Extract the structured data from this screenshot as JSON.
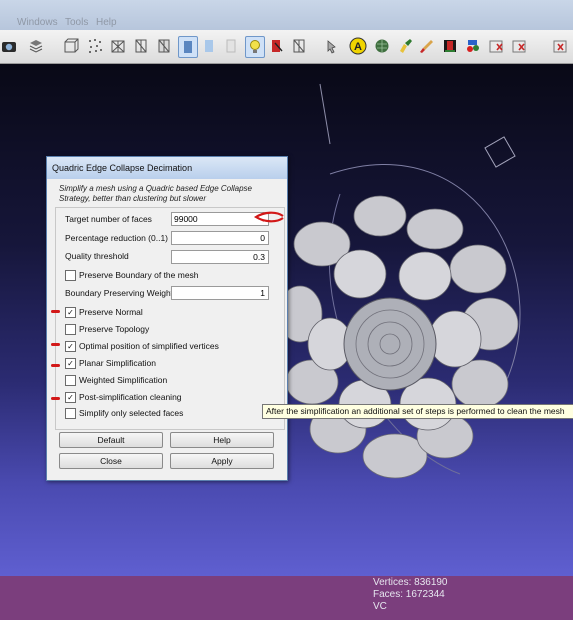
{
  "menubar": {
    "items": [
      "Windows",
      "Tools",
      "Help"
    ]
  },
  "toolbar": {
    "icons": [
      "snapshot-icon",
      "layers-icon",
      "bbox-icon",
      "points-icon",
      "wireframe-icon",
      "hidden-lines-icon",
      "flat-lines-icon",
      "flat-icon",
      "smooth-icon",
      "texture-icon",
      "light-icon",
      "color-icon",
      "normals-icon",
      "select-icon",
      "annotation-icon",
      "globe-icon",
      "paint-icon",
      "brush-icon",
      "measure-icon",
      "align-icon",
      "select-vertices-icon",
      "select-faces-icon",
      "connected-icon"
    ],
    "annotation_glyph": "A"
  },
  "dialog": {
    "title": "Quadric Edge Collapse Decimation",
    "description": "Simplify a mesh using a Quadric based Edge Collapse Strategy, better than clustering but slower",
    "target_faces_label": "Target number of faces",
    "target_faces_value": "99000",
    "percentage_label": "Percentage reduction (0..1)",
    "percentage_value": "0",
    "quality_label": "Quality threshold",
    "quality_value": "0.3",
    "preserve_boundary_label": "Preserve Boundary of the mesh",
    "preserve_boundary_checked": false,
    "boundary_weight_label": "Boundary Preserving Weight",
    "boundary_weight_value": "1",
    "options": [
      {
        "label": "Preserve Normal",
        "checked": true
      },
      {
        "label": "Preserve Topology",
        "checked": false
      },
      {
        "label": "Optimal position of simplified vertices",
        "checked": true
      },
      {
        "label": "Planar Simplification",
        "checked": true
      },
      {
        "label": "Weighted Simplification",
        "checked": false
      },
      {
        "label": "Post-simplification cleaning",
        "checked": true
      },
      {
        "label": "Simplify only selected faces",
        "checked": false
      }
    ],
    "buttons": {
      "default": "Default",
      "help": "Help",
      "close": "Close",
      "apply": "Apply"
    }
  },
  "tooltip": "After the simplification an additional set of steps is performed to clean the mesh",
  "status": {
    "vertices": "Vertices: 836190",
    "faces": "Faces: 1672344",
    "mode": "VC"
  },
  "colors": {
    "accent": "#d21818",
    "status_bar": "#7b3e7d",
    "viewport_bottom": "#5f5fd0"
  }
}
